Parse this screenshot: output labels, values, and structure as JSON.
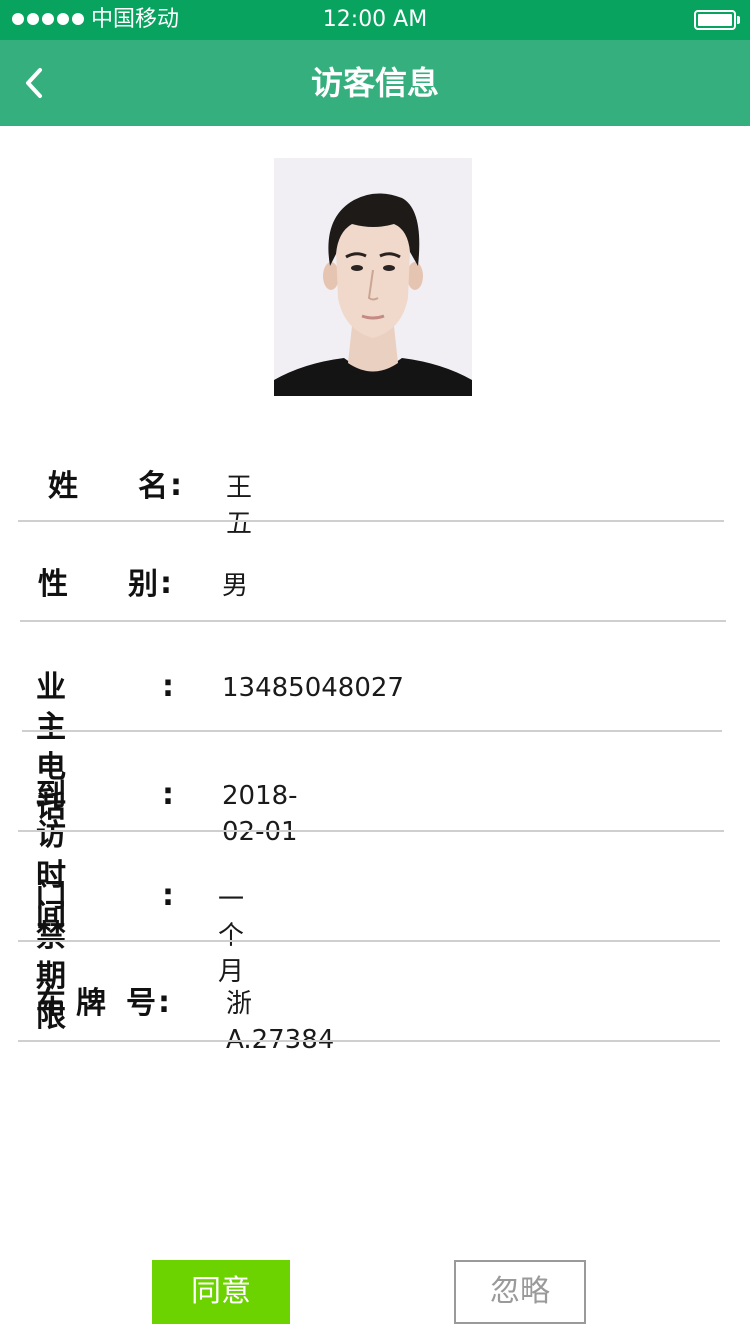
{
  "status_bar": {
    "carrier": "中国移动",
    "time": "12:00 AM"
  },
  "nav": {
    "title": "访客信息",
    "back_icon": "chevron-left-icon"
  },
  "visitor": {
    "name_label_1": "姓",
    "name_label_2": "名",
    "name": "王五",
    "gender_label_1": "性",
    "gender_label_2": "别",
    "gender": "男",
    "owner_phone_label": "业主电话",
    "owner_phone": "13485048027",
    "visit_time_label": "到访时间",
    "visit_time": "2018-02-01",
    "access_period_label": "门禁期限",
    "access_period": "一个月",
    "plate_label_1": "车",
    "plate_label_2": "牌",
    "plate_label_3": "号",
    "plate": "浙A.27384",
    "colon": ":"
  },
  "actions": {
    "agree": "同意",
    "ignore": "忽略"
  },
  "colors": {
    "status_bar": "#07a35f",
    "nav_bar": "#36af7e",
    "agree_button": "#6cd200",
    "ignore_border": "#9a9a9a"
  }
}
